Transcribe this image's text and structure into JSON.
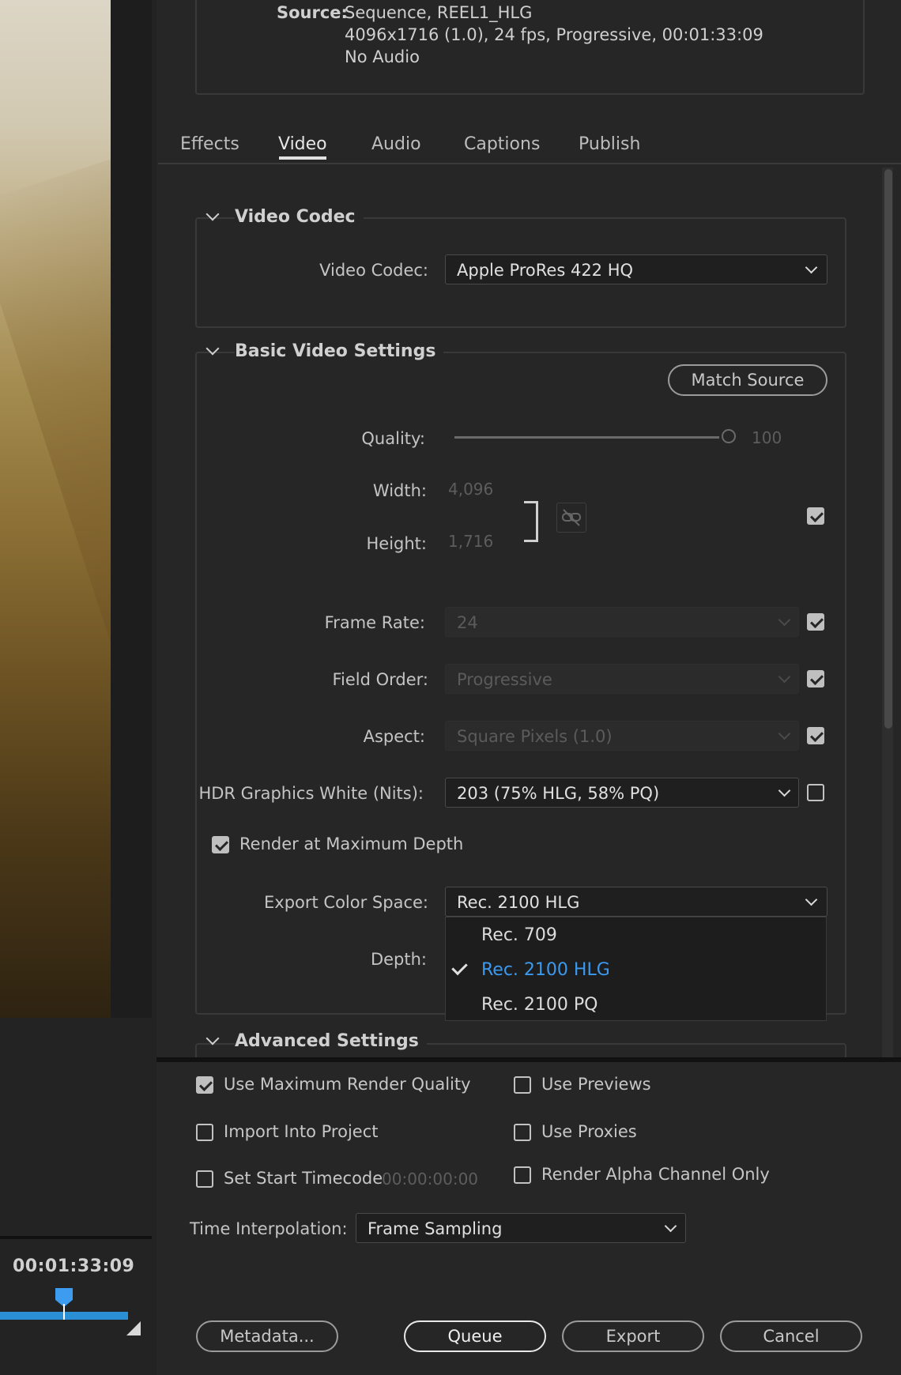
{
  "source": {
    "label": "Source:",
    "line1": "Sequence, REEL1_HLG",
    "line2": "4096x1716 (1.0), 24 fps, Progressive, 00:01:33:09",
    "line3": "No Audio"
  },
  "tabs": [
    {
      "label": "Effects"
    },
    {
      "label": "Video",
      "active": true
    },
    {
      "label": "Audio"
    },
    {
      "label": "Captions"
    },
    {
      "label": "Publish"
    }
  ],
  "video_codec": {
    "section_title": "Video Codec",
    "codec_label": "Video Codec:",
    "codec_value": "Apple ProRes 422 HQ"
  },
  "basic_video": {
    "section_title": "Basic Video Settings",
    "match_source": "Match Source",
    "quality_label": "Quality:",
    "quality_value": "100",
    "width_label": "Width:",
    "width_value": "4,096",
    "height_label": "Height:",
    "height_value": "1,716",
    "frame_rate_label": "Frame Rate:",
    "frame_rate_value": "24",
    "field_order_label": "Field Order:",
    "field_order_value": "Progressive",
    "aspect_label": "Aspect:",
    "aspect_value": "Square Pixels (1.0)",
    "hdr_label": "HDR Graphics White (Nits):",
    "hdr_value": "203 (75% HLG, 58% PQ)",
    "render_max_depth_label": "Render at Maximum Depth",
    "color_space_label": "Export Color Space:",
    "color_space_value": "Rec. 2100 HLG",
    "depth_label": "Depth:"
  },
  "color_space_menu": {
    "items": [
      {
        "label": "Rec. 709"
      },
      {
        "label": "Rec. 2100 HLG",
        "selected": true
      },
      {
        "label": "Rec. 2100 PQ"
      }
    ]
  },
  "advanced": {
    "section_title": "Advanced Settings"
  },
  "options": {
    "use_max_render_quality": "Use Maximum Render Quality",
    "use_previews": "Use Previews",
    "import_into_project": "Import Into Project",
    "use_proxies": "Use Proxies",
    "set_start_timecode": "Set Start Timecode",
    "start_timecode_value": "00:00:00:00",
    "render_alpha_only": "Render Alpha Channel Only",
    "time_interp_label": "Time Interpolation:",
    "time_interp_value": "Frame Sampling"
  },
  "buttons": {
    "metadata": "Metadata...",
    "queue": "Queue",
    "export": "Export",
    "cancel": "Cancel"
  },
  "timeline": {
    "timecode": "00:01:33:09"
  },
  "colors": {
    "accent_blue": "#3b9af0",
    "timeline_blue": "#2b8fd6",
    "panel_bg": "#262626"
  }
}
